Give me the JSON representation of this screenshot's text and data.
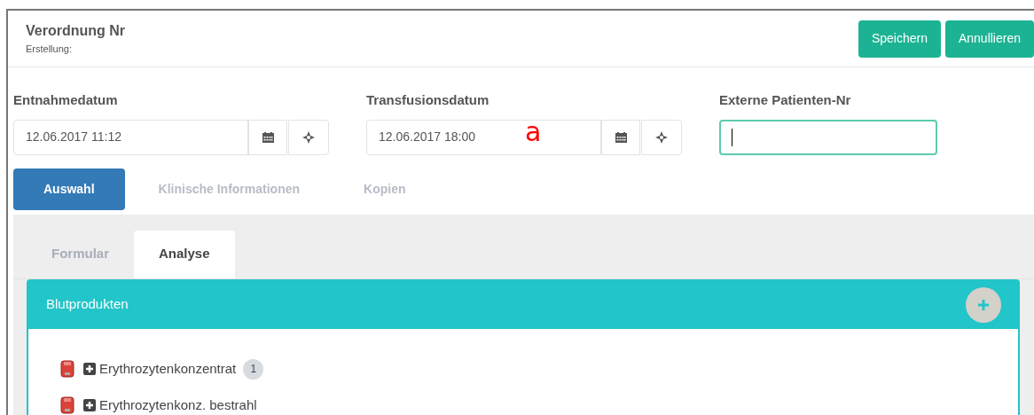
{
  "header": {
    "title": "Verordnung Nr",
    "subtitle": "Erstellung:",
    "buttons": [
      "Speichern",
      "Annullieren"
    ]
  },
  "fields": [
    {
      "kind": "date",
      "label": "Entnahmedatum",
      "value": "12.06.2017 11:12"
    },
    {
      "kind": "date",
      "label": "Transfusionsdatum",
      "value": "12.06.2017 18:00",
      "annotation": "a"
    },
    {
      "kind": "text",
      "label": "Externe Patienten-Nr",
      "focused": true
    }
  ],
  "tabs": [
    {
      "label": "Auswahl",
      "selected": true
    },
    {
      "label": "Klinische Informationen",
      "selected": false
    },
    {
      "label": "Kopien",
      "selected": false
    }
  ],
  "subtabs": [
    {
      "label": "Formular",
      "selected": false
    },
    {
      "label": "Analyse",
      "selected": true
    }
  ],
  "panel": {
    "title": "Blutprodukten",
    "items": [
      {
        "label": "Erythrozytenkonzentrat",
        "count": "1"
      },
      {
        "label": "Erythrozytenkonz. bestrahl"
      }
    ]
  }
}
